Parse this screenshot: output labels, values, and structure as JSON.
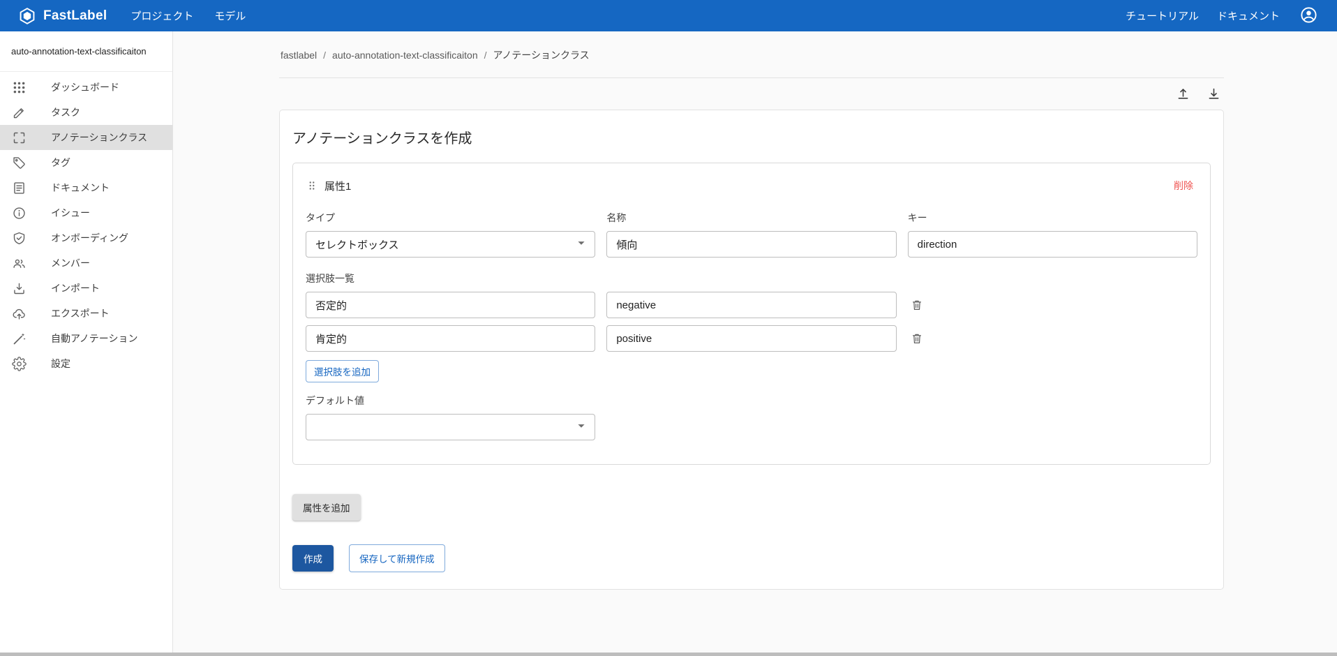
{
  "colors": {
    "topbar_bg": "#1567C2",
    "primary": "#1565C0",
    "primary_button_bg": "#1D57A0",
    "danger": "#EF5350",
    "selected_item_bg": "#E0E0E0",
    "page_bg": "#FAFAFA"
  },
  "topbar": {
    "brand": "FastLabel",
    "brand_icon": "hexagon-logo-icon",
    "nav": [
      {
        "label": "プロジェクト"
      },
      {
        "label": "モデル"
      }
    ],
    "right_nav": [
      {
        "label": "チュートリアル"
      },
      {
        "label": "ドキュメント"
      }
    ],
    "account_icon": "account-circle-icon"
  },
  "sidebar": {
    "project_name": "auto-annotation-text-classificaiton",
    "items": [
      {
        "label": "ダッシュボード",
        "icon": "apps-grid-icon",
        "selected": false
      },
      {
        "label": "タスク",
        "icon": "pencil-icon",
        "selected": false
      },
      {
        "label": "アノテーションクラス",
        "icon": "crop-free-icon",
        "selected": true
      },
      {
        "label": "タグ",
        "icon": "tag-icon",
        "selected": false
      },
      {
        "label": "ドキュメント",
        "icon": "document-icon",
        "selected": false
      },
      {
        "label": "イシュー",
        "icon": "info-circle-icon",
        "selected": false
      },
      {
        "label": "オンボーディング",
        "icon": "shield-check-icon",
        "selected": false
      },
      {
        "label": "メンバー",
        "icon": "people-icon",
        "selected": false
      },
      {
        "label": "インポート",
        "icon": "import-tray-icon",
        "selected": false
      },
      {
        "label": "エクスポート",
        "icon": "cloud-upload-icon",
        "selected": false
      },
      {
        "label": "自動アノテーション",
        "icon": "magic-wand-icon",
        "selected": false
      },
      {
        "label": "設定",
        "icon": "gear-icon",
        "selected": false
      }
    ]
  },
  "breadcrumb": {
    "separator": "/",
    "items": [
      "fastlabel",
      "auto-annotation-text-classificaiton",
      "アノテーションクラス"
    ]
  },
  "toolbar": {
    "upload_icon": "upload-icon",
    "download_icon": "download-icon"
  },
  "page": {
    "title": "アノテーションクラスを作成",
    "attribute": {
      "drag_icon": "drag-handle-icon",
      "title": "属性1",
      "delete_label": "削除",
      "fields": {
        "type_label": "タイプ",
        "type_value": "セレクトボックス",
        "name_label": "名称",
        "name_value": "傾向",
        "key_label": "キー",
        "key_value": "direction"
      },
      "options_label": "選択肢一覧",
      "options": [
        {
          "label": "否定的",
          "value": "negative"
        },
        {
          "label": "肯定的",
          "value": "positive"
        }
      ],
      "add_option_label": "選択肢を追加",
      "default_label": "デフォルト値",
      "default_value": ""
    },
    "add_attribute_label": "属性を追加",
    "actions": {
      "create_label": "作成",
      "save_and_new_label": "保存して新規作成"
    }
  }
}
